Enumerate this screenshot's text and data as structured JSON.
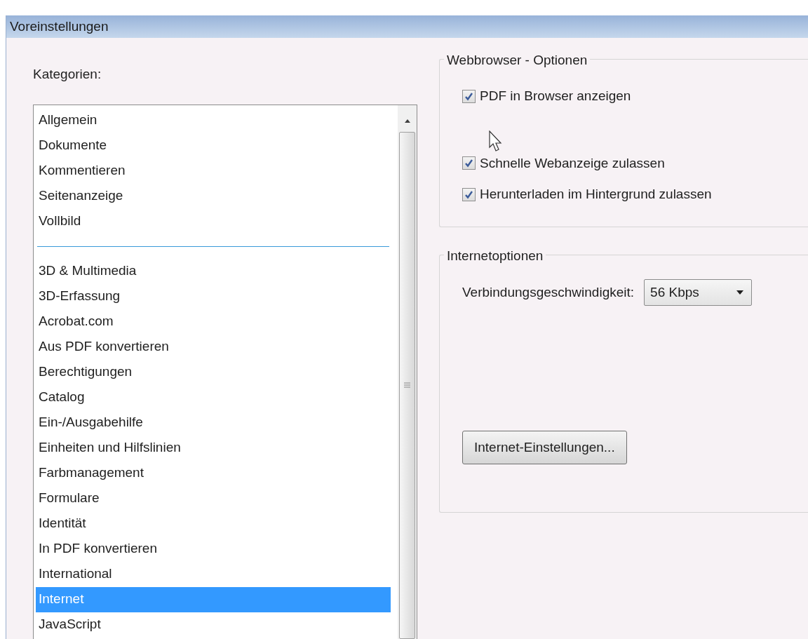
{
  "window": {
    "title": "Voreinstellungen"
  },
  "categories": {
    "label": "Kategorien:",
    "groups": [
      [
        {
          "label": "Allgemein",
          "selected": false
        },
        {
          "label": "Dokumente",
          "selected": false
        },
        {
          "label": "Kommentieren",
          "selected": false
        },
        {
          "label": "Seitenanzeige",
          "selected": false
        },
        {
          "label": "Vollbild",
          "selected": false
        }
      ],
      [
        {
          "label": "3D & Multimedia",
          "selected": false
        },
        {
          "label": "3D-Erfassung",
          "selected": false
        },
        {
          "label": "Acrobat.com",
          "selected": false
        },
        {
          "label": "Aus PDF konvertieren",
          "selected": false
        },
        {
          "label": "Berechtigungen",
          "selected": false
        },
        {
          "label": "Catalog",
          "selected": false
        },
        {
          "label": "Ein-/Ausgabehilfe",
          "selected": false
        },
        {
          "label": "Einheiten und Hilfslinien",
          "selected": false
        },
        {
          "label": "Farbmanagement",
          "selected": false
        },
        {
          "label": "Formulare",
          "selected": false
        },
        {
          "label": "Identität",
          "selected": false
        },
        {
          "label": "In PDF konvertieren",
          "selected": false
        },
        {
          "label": "International",
          "selected": false
        },
        {
          "label": "Internet",
          "selected": true
        },
        {
          "label": "JavaScript",
          "selected": false
        }
      ]
    ]
  },
  "web_options": {
    "title": "Webbrowser - Optionen",
    "checkboxes": [
      {
        "label": "PDF in Browser anzeigen",
        "checked": true
      },
      {
        "label": "Schnelle Webanzeige zulassen",
        "checked": true
      },
      {
        "label": "Herunterladen im Hintergrund zulassen",
        "checked": true
      }
    ]
  },
  "internet_options": {
    "title": "Internetoptionen",
    "speed_label": "Verbindungsgeschwindigkeit:",
    "speed_value": "56 Kbps",
    "button": "Internet-Einstellungen..."
  }
}
